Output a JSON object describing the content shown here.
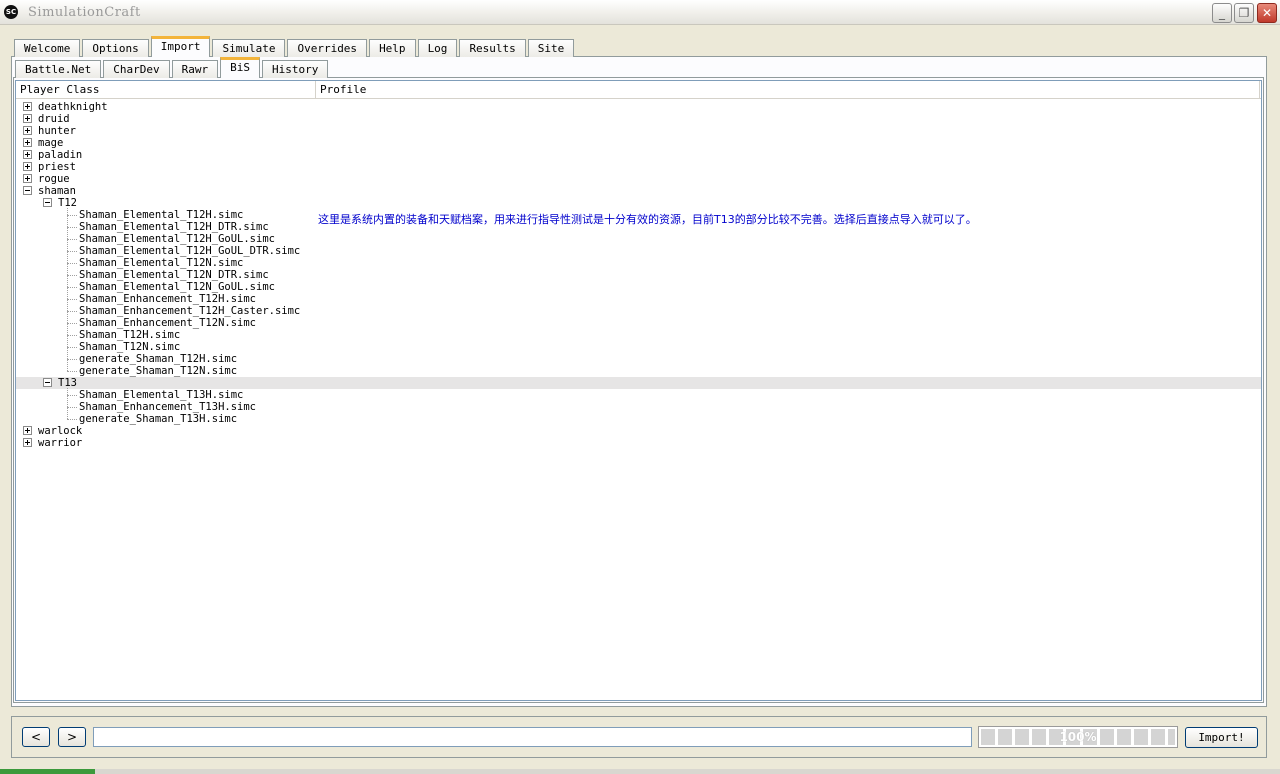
{
  "window": {
    "title": "SimulationCraft",
    "logo_text": "SC"
  },
  "main_tabs": [
    {
      "label": "Welcome"
    },
    {
      "label": "Options"
    },
    {
      "label": "Import"
    },
    {
      "label": "Simulate"
    },
    {
      "label": "Overrides"
    },
    {
      "label": "Help"
    },
    {
      "label": "Log"
    },
    {
      "label": "Results"
    },
    {
      "label": "Site"
    }
  ],
  "main_active_tab": "Import",
  "sub_tabs": [
    {
      "label": "Battle.Net"
    },
    {
      "label": "CharDev"
    },
    {
      "label": "Rawr"
    },
    {
      "label": "BiS"
    },
    {
      "label": "History"
    }
  ],
  "sub_active_tab": "BiS",
  "tree": {
    "columns": [
      "Player Class",
      "Profile"
    ],
    "classes_before": [
      "deathknight",
      "druid",
      "hunter",
      "mage",
      "paladin",
      "priest",
      "rogue"
    ],
    "expanded_class": "shaman",
    "tiers": [
      {
        "name": "T12",
        "profiles": [
          "Shaman_Elemental_T12H.simc",
          "Shaman_Elemental_T12H_DTR.simc",
          "Shaman_Elemental_T12H_GoUL.simc",
          "Shaman_Elemental_T12H_GoUL_DTR.simc",
          "Shaman_Elemental_T12N.simc",
          "Shaman_Elemental_T12N_DTR.simc",
          "Shaman_Elemental_T12N_GoUL.simc",
          "Shaman_Enhancement_T12H.simc",
          "Shaman_Enhancement_T12H_Caster.simc",
          "Shaman_Enhancement_T12N.simc",
          "Shaman_T12H.simc",
          "Shaman_T12N.simc",
          "generate_Shaman_T12H.simc",
          "generate_Shaman_T12N.simc"
        ]
      },
      {
        "name": "T13",
        "profiles": [
          "Shaman_Elemental_T13H.simc",
          "Shaman_Enhancement_T13H.simc",
          "generate_Shaman_T13H.simc"
        ]
      }
    ],
    "selected_row": "T13",
    "classes_after": [
      "warlock",
      "warrior"
    ]
  },
  "annotation": "这里是系统内置的装备和天赋档案，用来进行指导性测试是十分有效的资源，目前T13的部分比较不完善。选择后直接点导入就可以了。",
  "bottom": {
    "back_label": "<",
    "forward_label": ">",
    "command_value": "",
    "progress_text": "100%",
    "progress_value": 100,
    "import_label": "Import!"
  },
  "window_buttons": {
    "minimize": "_",
    "maximize": "❐",
    "close": "✕"
  }
}
